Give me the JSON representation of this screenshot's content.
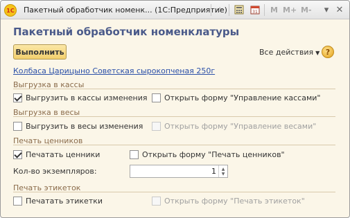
{
  "window": {
    "title": "Пакетный обработчик номенк...  (1С:Предприятие)",
    "logo_text": "1С",
    "toolbar_m_labels": [
      "M",
      "M+",
      "M-"
    ],
    "icons": [
      "star-icon",
      "calculator-icon",
      "calendar-icon",
      "dropdown-icon",
      "close-icon"
    ]
  },
  "form": {
    "title": "Пакетный обработчик номенклатуры",
    "run_button": "Выполнить",
    "all_actions": "Все действия",
    "help": "?",
    "item_link": "Колбаса Царицыно Советская сырокопченая 250г"
  },
  "groups": {
    "kassy": {
      "title": "Выгрузка в кассы",
      "upload_label": "Выгрузить в кассы изменения",
      "upload_checked": true,
      "open_form_label": "Открыть форму \"Управление кассами\"",
      "open_form_checked": false
    },
    "vesy": {
      "title": "Выгрузка в весы",
      "upload_label": "Выгрузить в весы изменения",
      "upload_checked": false,
      "open_form_label": "Открыть форму \"Управление весами\"",
      "open_form_enabled": false
    },
    "tsenniki": {
      "title": "Печать ценников",
      "print_label": "Печатать ценники",
      "print_checked": true,
      "open_form_label": "Открыть форму \"Печать ценников\"",
      "open_form_checked": false,
      "copies_label": "Кол-во экземпляров:",
      "copies_value": "1"
    },
    "etiketki": {
      "title": "Печать этикеток",
      "print_label": "Печатать этикетки",
      "print_checked": false,
      "open_form_label": "Открыть форму \"Печать этикеток\"",
      "open_form_enabled": false
    }
  }
}
